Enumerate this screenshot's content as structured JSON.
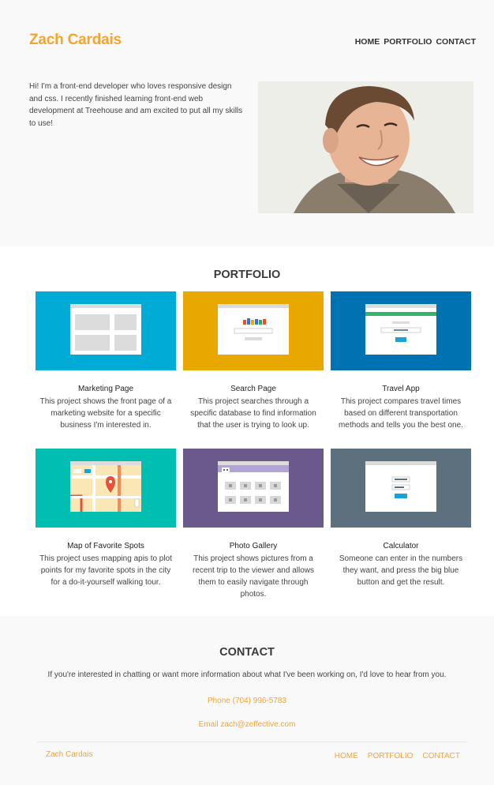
{
  "header": {
    "logo": "Zach Cardais",
    "nav": [
      "HOME",
      "PORTFOLIO",
      "CONTACT"
    ],
    "intro": "Hi! I'm a front-end developer who loves responsive design and css. I recently finished learning front-end web development at Treehouse and am excited to put all my skills to use!"
  },
  "portfolio": {
    "title": "PORTFOLIO",
    "cards": [
      {
        "title": "Marketing Page",
        "desc": "This project shows the front page of a marketing website for a specific business I'm interested in.",
        "color": "#00acd6"
      },
      {
        "title": "Search Page",
        "desc": "This project searches through a specific database to find information that the user is trying to look up.",
        "color": "#e8a800"
      },
      {
        "title": "Travel App",
        "desc": "This project compares travel times based on different transportation methods and tells you the best one.",
        "color": "#0071b1"
      },
      {
        "title": "Map of Favorite Spots",
        "desc": "This project uses mapping apis to plot points for my favorite spots in the city for a do-it-yourself walking tour.",
        "color": "#00bfb2"
      },
      {
        "title": "Photo Gallery",
        "desc": "This project shows pictures from a recent trip to the viewer and allows them to easily navigate through photos.",
        "color": "#6a5a8c"
      },
      {
        "title": "Calculator",
        "desc": "Someone can enter in the numbers they want, and press the big blue button and get the result.",
        "color": "#5d707e"
      }
    ]
  },
  "contact": {
    "title": "CONTACT",
    "text": "If you're interested in chatting or want more information about what I've been working on, I'd love to hear from you.",
    "phone_label": "Phone",
    "phone": "(704) 996-5783",
    "email_label": "Email",
    "email": "zach@zeffective.com"
  },
  "footer": {
    "logo": "Zach Cardais",
    "nav": [
      "HOME",
      "PORTFOLIO",
      "CONTACT"
    ]
  },
  "colors": {
    "accent": "#f5a431",
    "text": "#3a3a3a"
  }
}
